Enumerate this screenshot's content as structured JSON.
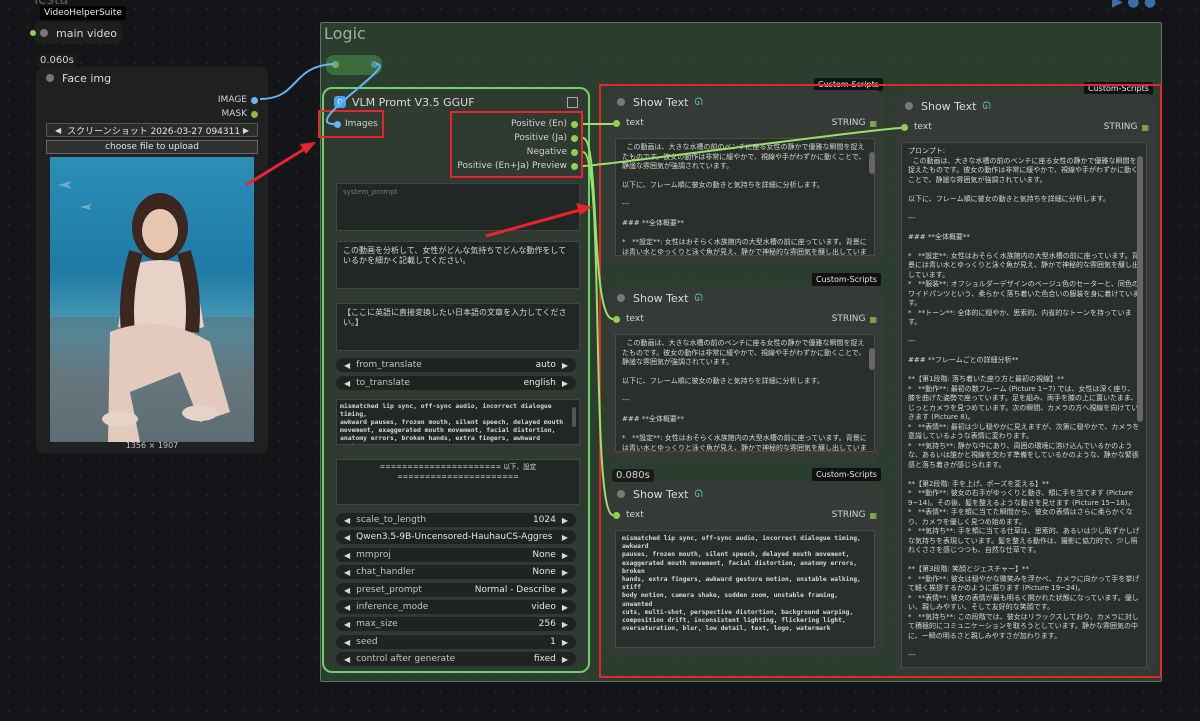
{
  "top_fragment": "Testa",
  "vhs_badge": "VideoHelperSuite",
  "main_video": "main video",
  "time_a": "0.060s",
  "face": {
    "title": "Face img",
    "out_image": "IMAGE",
    "out_mask": "MASK",
    "file": "スクリーンショット 2026-03-27 094311 ...",
    "upload": "choose file to upload",
    "size": "1356 × 1907"
  },
  "group_title": "Logic",
  "vlm": {
    "title": "VLM Promt V3.5 GGUF",
    "in_images": "Images",
    "outputs": [
      "Positive (En)",
      "Positive (Ja)",
      "Negative",
      "Positive (En+Ja) Preview"
    ],
    "system_prompt_placeholder": "system_prompt",
    "prompt_ja": "この動画を分析して、女性がどんな気持ちでどんな動作をしているかを細かく記載してください。",
    "direct_ja": "【ここに英語に直接変換したい日本語の文章を入力してください。】",
    "from_translate": {
      "label": "from_translate",
      "value": "auto"
    },
    "to_translate": {
      "label": "to_translate",
      "value": "english"
    },
    "negative": "mismatched lip sync, off-sync audio, incorrect dialogue timing,\nawkward pauses, frozen mouth, silent speech, delayed mouth\nmovement, exaggerated mouth movement, facial distortion,\nanatomy errors, broken hands, extra fingers, awkward gesture\nmotion, unstable walking, stiff body motion, camera shake,\nsudden zoom, unstable framing, unwanted cuts, multi-shot,",
    "divider": "====================== 以下、設定 ======================",
    "settings": [
      {
        "label": "scale_to_length",
        "value": "1024"
      },
      {
        "label": "",
        "value": "Qwen3.5-9B-Uncensored-HauhauCS-Aggres ..."
      },
      {
        "label": "mmproj",
        "value": "None"
      },
      {
        "label": "chat_handler",
        "value": "None"
      },
      {
        "label": "preset_prompt",
        "value": "Normal - Describe"
      },
      {
        "label": "inference_mode",
        "value": "video"
      },
      {
        "label": "max_size",
        "value": "256"
      },
      {
        "label": "seed",
        "value": "1"
      },
      {
        "label": "control after generate",
        "value": "fixed"
      }
    ]
  },
  "custom_scripts": "Custom-Scripts",
  "show_text": {
    "title": "Show Text",
    "input": "text",
    "type": "STRING"
  },
  "time_b": "0.080s",
  "st1_text": "  この動画は、大きな水槽の前のベンチに座る女性の静かで優雅な瞬間を捉えたものです。彼女の動作は非常に緩やかで、視線や手がわずかに動くことで、静謐な雰囲気が強調されています。\n\n以下に、フレーム順に彼女の動きと気持ちを詳細に分析します。\n\n---\n\n### **全体概要**\n\n*   **設定**: 女性はおそらく水族館内の大型水槽の前に座っています。背景には青い水とゆっくりと泳ぐ魚が見え、静かで神秘的な雰囲気を醸し出しています。\n*   **服装**: オフショルダーデザインのベージュ色のセーターと、同色のワイドパンツという、柔らかく落ち着いた色合いの服装を身に着けています。",
  "st2_text": "  この動画は、大きな水槽の前のベンチに座る女性の静かで優雅な瞬間を捉えたものです。彼女の動作は非常に緩やかで、視線や手がわずかに動くことで、静謐な雰囲気が強調されています。\n\n以下に、フレーム順に彼女の動きと気持ちを詳細に分析します。\n\n---\n\n### **全体概要**\n\n*   **設定**: 女性はおそらく水族館内の大型水槽の前に座っています。背景には青い水とゆっくりと泳ぐ魚が見え、静かで神秘的な雰囲気を醸し出しています。\n*   **服装**: オフショルダーデザインのベージュ色のセーターと、同色のワイドパンツという、柔らかく落ち着いた色合いの服装を身に着けています。",
  "st3_text": "mismatched lip sync, off-sync audio, incorrect dialogue timing, awkward\npauses, frozen mouth, silent speech, delayed mouth movement,\nexaggerated mouth movement, facial distortion, anatomy errors, broken\nhands, extra fingers, awkward gesture motion, unstable walking, stiff\nbody motion, camera shake, sudden zoom, unstable framing, unwanted\ncuts, multi-shot, perspective distortion, background warping,\ncomposition drift, inconsistent lighting, flickering light,\noversaturation, blur, low detail, text, logo, watermark",
  "st4_text": "プロンプト:\n  この動画は、大きな水槽の前のベンチに座る女性の静かで優雅な瞬間を捉えたものです。彼女の動作は非常に緩やかで、視線や手がわずかに動くことで、静謐な雰囲気が強調されています。\n\n以下に、フレーム順に彼女の動きと気持ちを詳細に分析します。\n\n---\n\n### **全体概要**\n\n*   **設定**: 女性はおそらく水族館内の大型水槽の前に座っています。背景には青い水とゆっくりと泳ぐ魚が見え、静かで神秘的な雰囲気を醸し出しています。\n*   **服装**: オフショルダーデザインのベージュ色のセーターと、同色のワイドパンツという、柔らかく落ち着いた色合いの服装を身に着けています。\n*   **トーン**: 全体的に穏やか、思索的、内省的なトーンを持っています。\n\n---\n\n### **フレームごとの詳細分析**\n\n**【第1段階: 落ち着いた座り方と最初の視線】**\n*   **動作**: 最初の数フレーム (Picture 1~7) では、女性は深く座り、膝を曲げた姿勢で座っています。足を組み、両手を膝の上に置いたまま、じっとカメラを見つめています。次の瞬間、カメラの方へ視線を向けていきます (Picture 8)。\n*   **表情**: 最初は少し穏やかに見えますが、次第に穏やかで、カメラを意識しているような表情に変わります。\n*   **気持ち**: 静かな中にあり、周囲の環境に溶け込んでいるかのような、あるいは誰かと視線を交わす準備をしているかのような、静かな緊張感と落ち着きが感じられます。\n\n**【第2段階: 手を上げ、ポーズを変える】**\n*   **動作**: 彼女の右手がゆっくりと動き、頬に手を当てます (Picture 9~14)。その後、髪を整えるような動きを見せます (Picture 15~18)。\n*   **表情**: 手を頬に当てた瞬間から、彼女の表情はさらに柔らかくなり、カメラを優しく見つめ始めます。\n*   **気持ち**: 手を頬に当てる仕草は、思索的、あるいは少し恥ずかしげな気持ちを表現しています。髪を整える動作は、撮影に協力的で、少し照れくささを感じつつも、自然な仕草です。\n\n**【第3段階: 笑顔とジェスチャー】**\n*   **動作**: 彼女は穏やかな微笑みを浮かべ、カメラに向かって手を挙げて軽く挨拶するかのように振ります (Picture 19~24)。\n*   **表情**: 彼女の表情が最も明るく開かれた状態になっています。優しい、親しみやすい、そして友好的な笑顔です。\n*   **気持ち**: この段階では、彼女はリラックスしており、カメラに対して積極的にコミュニケーションを取ろうとしています。静かな雰囲気の中に、一瞬の明るさと親しみやすさが加わります。\n\n---\n\n### **まとめ**\n\nこの動画は、女性が静かな環境の中で、内省的な状態から始まり、次第に外の世界 (カメラ) と向き合い、最終的には温かみのある笑顔で応えるというプロセスを描写しています。\n\n彼女の動きは、**「静けさ → 思索 → 開放 → 親しみやすさ」**という流れを辿り、一貫して優雅で落ち着いた印象を与えます。背景の水族館の青い光と美しく調和した、心穏やかな映像となっています。\n\n==================================\n\n日本語訳:\n  この動画は、大きな水槽の前のベンチに座る女性の静かで優雅な瞬間を捉えたものです。"
}
